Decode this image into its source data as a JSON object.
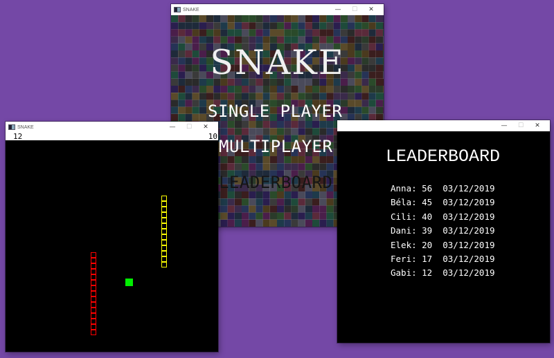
{
  "menu_window": {
    "title": "SNAKE",
    "controls": {
      "minimize": "—",
      "maximize": "☐",
      "close": "✕"
    },
    "game_title": "SNAKE",
    "items": [
      "SINGLE PLAYER",
      "MULTIPLAYER",
      "LEADERBOARD"
    ]
  },
  "game_window": {
    "title": "SNAKE",
    "controls": {
      "minimize": "—",
      "maximize": "☐",
      "close": "✕"
    },
    "scores": {
      "player1": "12",
      "player2": "10"
    },
    "colors": {
      "background": "#000000",
      "snake_yellow": "#ffff00",
      "snake_red": "#ff0000",
      "food": "#00ee00"
    }
  },
  "leaderboard_window": {
    "title": "SNAKE",
    "controls": {
      "minimize": "—",
      "maximize": "☐",
      "close": "✕"
    },
    "heading": "LEADERBOARD",
    "entries": [
      {
        "name": "Anna",
        "score": "56",
        "date": "03/12/2019"
      },
      {
        "name": "Béla",
        "score": "45",
        "date": "03/12/2019"
      },
      {
        "name": "Cili",
        "score": "40",
        "date": "03/12/2019"
      },
      {
        "name": "Dani",
        "score": "39",
        "date": "03/12/2019"
      },
      {
        "name": "Elek",
        "score": "20",
        "date": "03/12/2019"
      },
      {
        "name": "Feri",
        "score": "17",
        "date": "03/12/2019"
      },
      {
        "name": "Gabi",
        "score": "12",
        "date": "03/12/2019"
      }
    ]
  }
}
